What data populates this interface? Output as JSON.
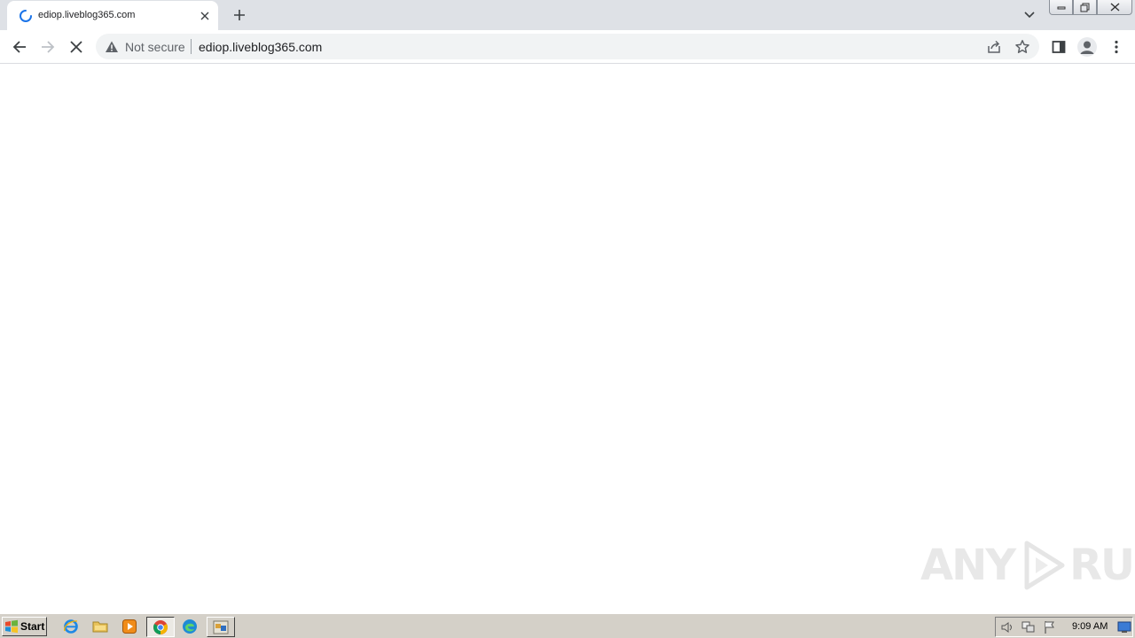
{
  "browser": {
    "tab": {
      "title": "ediop.liveblog365.com",
      "state": "loading-spinner-icon"
    },
    "address_bar": {
      "security_label": "Not secure",
      "url": "ediop.liveblog365.com"
    },
    "icons": [
      "back-arrow-icon",
      "forward-arrow-icon",
      "stop-loading-icon",
      "warning-triangle-icon",
      "share-icon",
      "star-icon",
      "side-panel-icon",
      "profile-avatar-icon",
      "more-menu-icon",
      "new-tab-plus-icon",
      "tab-search-chevron-icon"
    ]
  },
  "watermark": {
    "left": "ANY",
    "right": "RUN"
  },
  "taskbar": {
    "start_label": "Start",
    "clock": "9:09 AM",
    "quick_launch": [
      "internet-explorer-icon",
      "folder-icon",
      "media-player-icon"
    ],
    "tasks": [
      "chrome-icon",
      "edge-icon",
      "app-task-icon"
    ],
    "tray": [
      "speaker-icon",
      "network-icon",
      "action-center-flag-icon",
      "show-desktop-icon"
    ]
  },
  "colors": {
    "tabstrip": "#dee1e6",
    "omnibox": "#f1f3f4",
    "taskbar": "#d4d0c8",
    "spinner": "#1a73e8"
  }
}
